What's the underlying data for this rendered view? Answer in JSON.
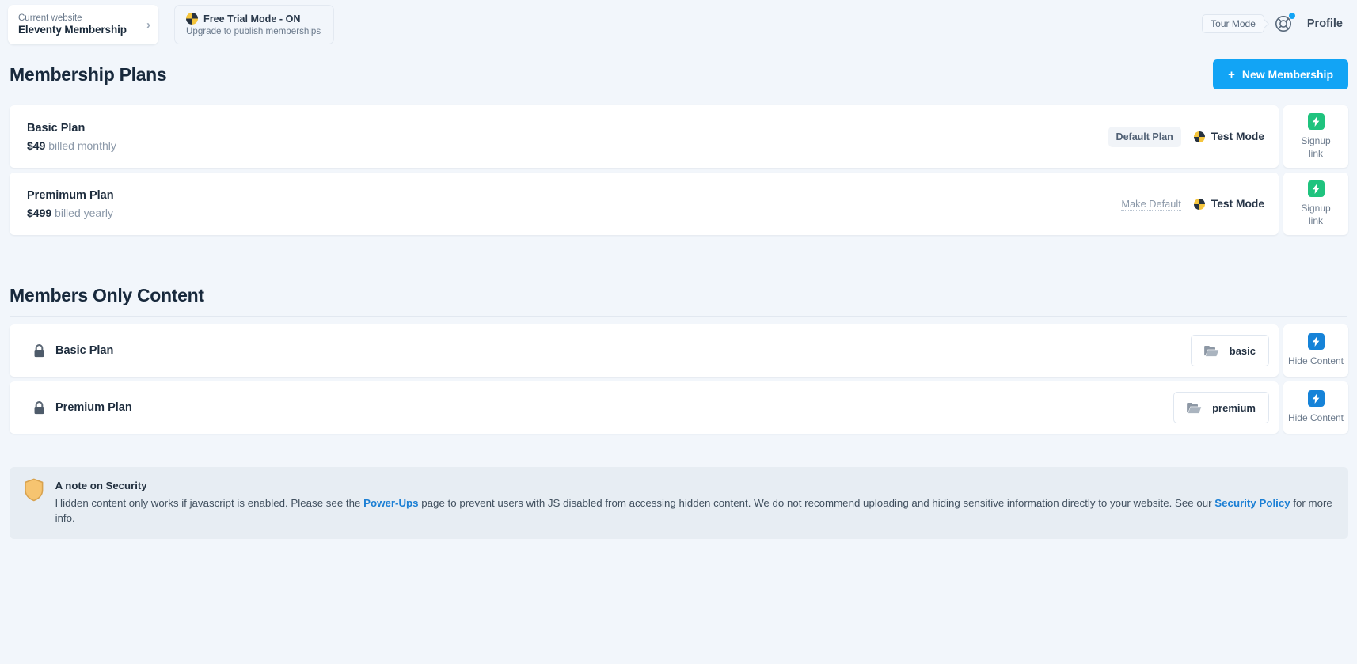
{
  "topbar": {
    "site": {
      "label": "Current website",
      "name": "Eleventy Membership",
      "chevron": "chevron-right-icon"
    },
    "trial": {
      "title": "Free Trial Mode - ON",
      "subtitle": "Upgrade to publish memberships",
      "icon": "test-mode-pie-icon"
    },
    "tour_mode": "Tour Mode",
    "help_icon": "life-ring-help-icon",
    "profile": "Profile",
    "notification_dot_color": "#12a4f5"
  },
  "plans_section": {
    "title": "Membership Plans",
    "new_button": {
      "label": "New Membership",
      "plus": "+",
      "color": "#12a4f5"
    },
    "plans": [
      {
        "name": "Basic Plan",
        "price": "$49",
        "billing": "billed monthly",
        "default_state": "Default Plan",
        "default_is_pill": true,
        "mode": "Test Mode",
        "mode_icon": "test-mode-pie-icon",
        "side": {
          "label_line1": "Signup",
          "label_line2": "link",
          "bolt_color": "#1fc37e",
          "icon": "bolt-icon"
        }
      },
      {
        "name": "Premimum Plan",
        "price": "$499",
        "billing": "billed yearly",
        "default_state": "Make Default",
        "default_is_pill": false,
        "mode": "Test Mode",
        "mode_icon": "test-mode-pie-icon",
        "side": {
          "label_line1": "Signup",
          "label_line2": "link",
          "bolt_color": "#1fc37e",
          "icon": "bolt-icon"
        }
      }
    ]
  },
  "content_section": {
    "title": "Members Only Content",
    "items": [
      {
        "name": "Basic Plan",
        "lock_icon": "lock-icon",
        "tag": "basic",
        "tag_icon": "folder-open-icon",
        "side": {
          "label": "Hide Content",
          "bolt_color": "#1683d8",
          "icon": "bolt-icon"
        }
      },
      {
        "name": "Premium Plan",
        "lock_icon": "lock-icon",
        "tag": "premium",
        "tag_icon": "folder-open-icon",
        "side": {
          "label": "Hide Content",
          "bolt_color": "#1683d8",
          "icon": "bolt-icon"
        }
      }
    ]
  },
  "security_note": {
    "icon": "shield-icon",
    "title": "A note on Security",
    "text_part1": "Hidden content only works if javascript is enabled. Please see the ",
    "link1": "Power-Ups",
    "text_part2": " page to prevent users with JS disabled from accessing hidden content.  We do not recommend uploading and hiding sensitive information directly to your website. See our ",
    "link2": "Security Policy",
    "text_part3": " for more info."
  }
}
